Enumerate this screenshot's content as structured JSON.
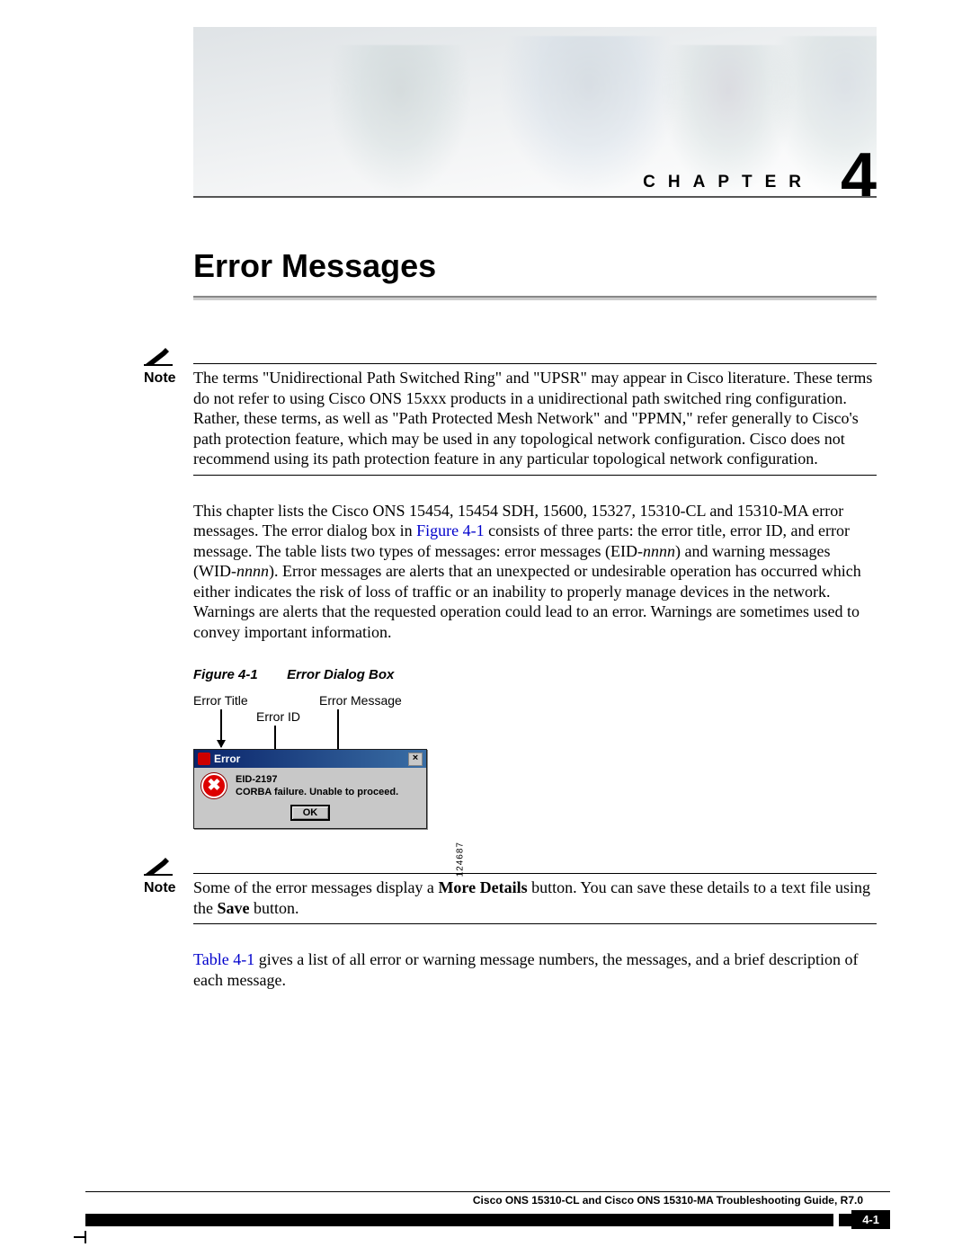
{
  "header": {
    "chapter_label": "CHAPTER",
    "chapter_number": "4"
  },
  "title": "Error Messages",
  "note1": {
    "label": "Note",
    "text": "The terms \"Unidirectional Path Switched Ring\" and \"UPSR\" may appear in Cisco literature. These terms do not refer to using Cisco ONS 15xxx products in a unidirectional path switched ring configuration. Rather, these terms, as well as \"Path Protected Mesh Network\" and \"PPMN,\" refer generally to Cisco's path protection feature, which may be used in any topological network configuration. Cisco does not recommend using its path protection feature in any particular topological network configuration."
  },
  "para1": {
    "pre": "This chapter lists the Cisco ONS 15454, 15454 SDH, 15600, 15327, 15310-CL and 15310-MA error messages. The error dialog box in ",
    "link1": "Figure 4-1",
    "mid1": " consists of three parts: the error title, error ID, and error message. The table lists two types of messages: error messages (EID-",
    "nnnn1": "nnnn",
    "mid2": ") and warning messages (WID-",
    "nnnn2": "nnnn",
    "post": "). Error messages are alerts that an unexpected or undesirable operation has occurred which either indicates the risk of loss of traffic or an inability to properly manage devices in the network. Warnings are alerts that the requested operation could lead to an error. Warnings are sometimes used to convey important information."
  },
  "figure": {
    "label": "Figure 4-1",
    "caption": "Error Dialog Box",
    "callouts": {
      "title": "Error Title",
      "id": "Error ID",
      "message": "Error Message"
    },
    "dialog": {
      "title": "Error",
      "close": "×",
      "eid": "EID-2197",
      "msg": "CORBA failure.  Unable to proceed.",
      "ok": "OK",
      "error_glyph": "✖"
    },
    "side_number": "124687"
  },
  "note2": {
    "label": "Note",
    "pre": "Some of the error messages display a ",
    "b1": "More Details",
    "mid": " button. You can save these details to a text file using the ",
    "b2": "Save",
    "post": " button."
  },
  "para2": {
    "link": "Table 4-1",
    "post": " gives a list of all error or warning message numbers, the messages, and a brief description of each message."
  },
  "footer": {
    "doc_title": "Cisco ONS 15310-CL and Cisco ONS 15310-MA Troubleshooting Guide, R7.0",
    "page": "4-1"
  }
}
